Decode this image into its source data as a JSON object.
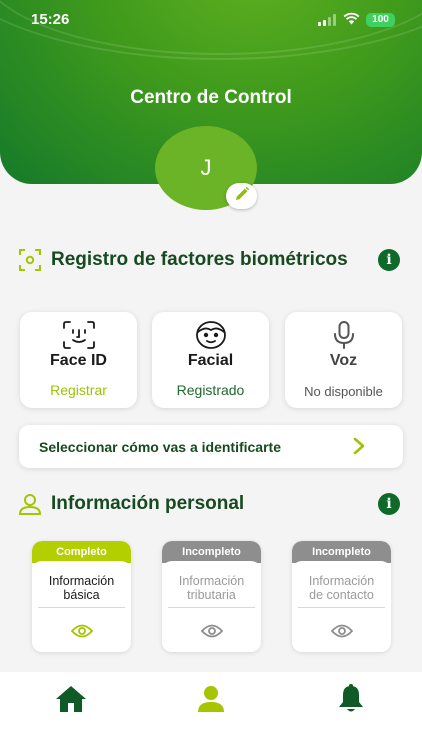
{
  "status_bar": {
    "time": "15:26",
    "battery": "100"
  },
  "header": {
    "title": "Centro de Control",
    "avatar_initial": "J"
  },
  "biometrics": {
    "title": "Registro de factores biométricos",
    "cards": [
      {
        "name": "Face ID",
        "status": "Registrar",
        "icon": "face-id-icon",
        "status_color": "#9cc200"
      },
      {
        "name": "Facial",
        "status": "Registrado",
        "icon": "face-icon",
        "status_color": "#1f6b2c"
      },
      {
        "name": "Voz",
        "status": "No disponible",
        "icon": "microphone-icon",
        "status_color": "#555555"
      }
    ],
    "select_label": "Seleccionar cómo vas a identificarte"
  },
  "personal": {
    "title": "Información personal",
    "cards": [
      {
        "badge": "Completo",
        "label_line1": "Información",
        "label_line2": "básica",
        "badge_color": "#b3cf00"
      },
      {
        "badge": "Incompleto",
        "label_line1": "Información",
        "label_line2": "tributaria",
        "badge_color": "#8e8e8e"
      },
      {
        "badge": "Incompleto",
        "label_line1": "Información",
        "label_line2": "de contacto",
        "badge_color": "#8e8e8e"
      }
    ]
  },
  "tabbar": {
    "items": [
      "home-icon",
      "user-icon",
      "bell-icon"
    ],
    "active": "user-icon"
  },
  "colors": {
    "brand_dark": "#0f6a2a",
    "brand_light": "#b3cf00",
    "header_green": "#3f9a1c"
  }
}
